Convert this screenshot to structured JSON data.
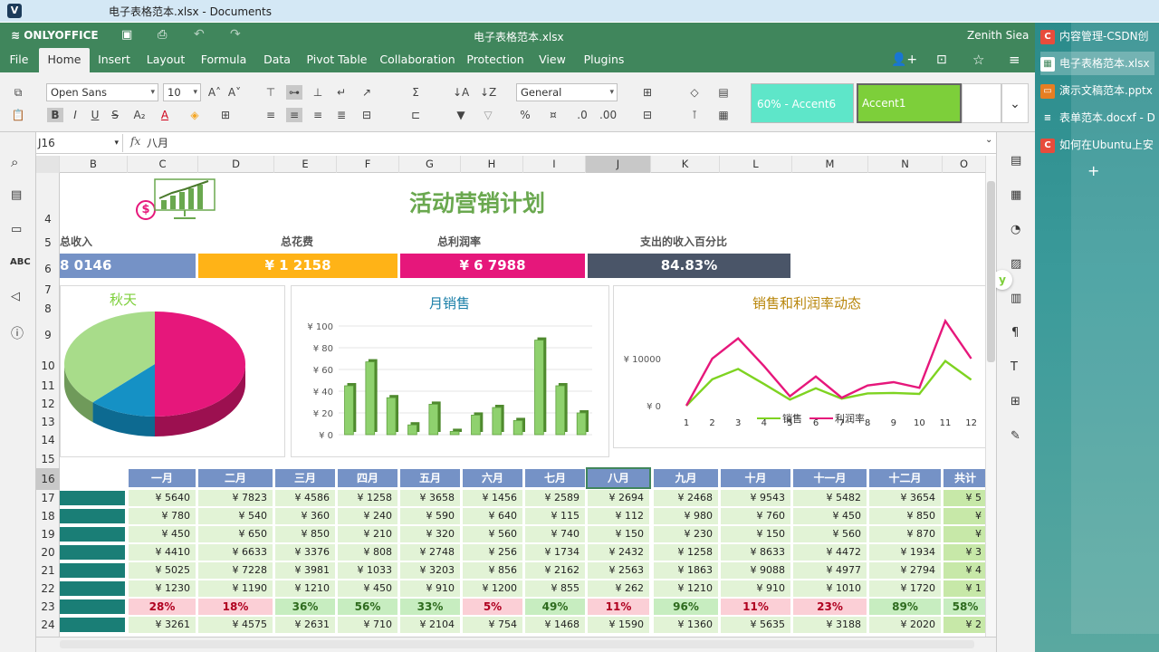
{
  "window": {
    "title": "电子表格范本.xlsx - Documents",
    "logo": "V"
  },
  "header": {
    "app": "ONLYOFFICE",
    "filename": "电子表格范本.xlsx",
    "user": "Zenith Siea"
  },
  "tabs": [
    "File",
    "Home",
    "Insert",
    "Layout",
    "Formula",
    "Data",
    "Pivot Table",
    "Collaboration",
    "Protection",
    "View",
    "Plugins"
  ],
  "toolbar": {
    "font": "Open Sans",
    "size": "10",
    "number_format": "General",
    "style1": "60% - Accent6",
    "style2": "Accent1"
  },
  "formula": {
    "cell": "J16",
    "fx": "fx",
    "value": "八月"
  },
  "columns": [
    "B",
    "C",
    "D",
    "E",
    "F",
    "G",
    "H",
    "I",
    "J",
    "K",
    "L",
    "M",
    "N",
    "O"
  ],
  "rows": [
    "4",
    "5",
    "6",
    "7",
    "8",
    "9",
    "10",
    "11",
    "12",
    "13",
    "14",
    "15",
    "16",
    "17",
    "18",
    "19",
    "20",
    "21",
    "22",
    "23",
    "24"
  ],
  "sheet": {
    "title": "活动营销计划",
    "kpis": [
      {
        "label": "总收入",
        "value": "8 0146",
        "color": "#7592c6"
      },
      {
        "label": "总花费",
        "value": "¥ 1 2158",
        "color": "#ffb317"
      },
      {
        "label": "总利润率",
        "value": "¥ 6 7988",
        "color": "#e6177b"
      },
      {
        "label": "支出的收入百分比",
        "value": "84.83%",
        "color": "#4a5568"
      }
    ],
    "months": [
      "一月",
      "二月",
      "三月",
      "四月",
      "五月",
      "六月",
      "七月",
      "八月",
      "九月",
      "十月",
      "十一月",
      "十二月",
      "共计"
    ],
    "data_rows": [
      [
        "¥ 5640",
        "¥ 7823",
        "¥ 4586",
        "¥ 1258",
        "¥ 3658",
        "¥ 1456",
        "¥ 2589",
        "¥ 2694",
        "¥ 2468",
        "¥ 9543",
        "¥ 5482",
        "¥ 3654",
        "¥ 5"
      ],
      [
        "¥ 780",
        "¥ 540",
        "¥ 360",
        "¥ 240",
        "¥ 590",
        "¥ 640",
        "¥ 115",
        "¥ 112",
        "¥ 980",
        "¥ 760",
        "¥ 450",
        "¥ 850",
        "¥"
      ],
      [
        "¥ 450",
        "¥ 650",
        "¥ 850",
        "¥ 210",
        "¥ 320",
        "¥ 560",
        "¥ 740",
        "¥ 150",
        "¥ 230",
        "¥ 150",
        "¥ 560",
        "¥ 870",
        "¥"
      ],
      [
        "¥ 4410",
        "¥ 6633",
        "¥ 3376",
        "¥ 808",
        "¥ 2748",
        "¥ 256",
        "¥ 1734",
        "¥ 2432",
        "¥ 1258",
        "¥ 8633",
        "¥ 4472",
        "¥ 1934",
        "¥ 3"
      ],
      [
        "¥ 5025",
        "¥ 7228",
        "¥ 3981",
        "¥ 1033",
        "¥ 3203",
        "¥ 856",
        "¥ 2162",
        "¥ 2563",
        "¥ 1863",
        "¥ 9088",
        "¥ 4977",
        "¥ 2794",
        "¥ 4"
      ],
      [
        "¥ 1230",
        "¥ 1190",
        "¥ 1210",
        "¥ 450",
        "¥ 910",
        "¥ 1200",
        "¥ 855",
        "¥ 262",
        "¥ 1210",
        "¥ 910",
        "¥ 1010",
        "¥ 1720",
        "¥ 1"
      ]
    ],
    "pct_row": [
      "28%",
      "18%",
      "36%",
      "56%",
      "33%",
      "5%",
      "49%",
      "11%",
      "96%",
      "11%",
      "23%",
      "89%",
      "58%"
    ],
    "last_row": [
      "¥ 3261",
      "¥ 4575",
      "¥ 2631",
      "¥ 710",
      "¥ 2104",
      "¥ 754",
      "¥ 1468",
      "¥ 1590",
      "¥ 1360",
      "¥ 5635",
      "¥ 3188",
      "¥ 2020",
      "¥ 2"
    ]
  },
  "chart_data": [
    {
      "type": "pie",
      "title": "秋天",
      "values": [
        50,
        12,
        38
      ],
      "colors": [
        "#e6177b",
        "#1591c5",
        "#a8dc8a"
      ]
    },
    {
      "type": "bar",
      "title": "月销售",
      "yticks": [
        "¥ 100",
        "¥ 80",
        "¥ 60",
        "¥ 40",
        "¥ 20",
        "¥ 0"
      ],
      "ylim": [
        0,
        100
      ],
      "values": [
        45,
        67,
        34,
        9,
        28,
        3,
        18,
        25,
        13,
        87,
        45,
        20
      ]
    },
    {
      "type": "line",
      "title": "销售和利润率动态",
      "yticks": [
        "¥ 20000",
        "¥ 10000",
        "¥ 0"
      ],
      "ylim": [
        0,
        20000
      ],
      "x": [
        "1",
        "2",
        "3",
        "4",
        "5",
        "6",
        "7",
        "8",
        "9",
        "10",
        "11",
        "12"
      ],
      "series": [
        {
          "name": "销售",
          "color": "#7ed321",
          "values": [
            0,
            5600,
            7800,
            4600,
            1300,
            3700,
            1500,
            2600,
            2700,
            2500,
            9500,
            5500
          ]
        },
        {
          "name": "利润率",
          "color": "#e6177b",
          "values": [
            0,
            10000,
            14300,
            8400,
            2000,
            6200,
            1700,
            4300,
            5000,
            3800,
            18000,
            10000
          ]
        }
      ]
    }
  ],
  "sidepanel": {
    "items": [
      {
        "label": "内容管理-CSDN创",
        "icon": "C",
        "color": "#e74c3c"
      },
      {
        "label": "电子表格范本.xlsx",
        "icon": "▦",
        "color": "#40865c"
      },
      {
        "label": "演示文稿范本.pptx",
        "icon": "▭",
        "color": "#e67e22"
      },
      {
        "label": "表单范本.docxf - D",
        "icon": "≡",
        "color": "#3a6fb5"
      },
      {
        "label": "如何在Ubuntu上安",
        "icon": "C",
        "color": "#e74c3c"
      }
    ]
  }
}
